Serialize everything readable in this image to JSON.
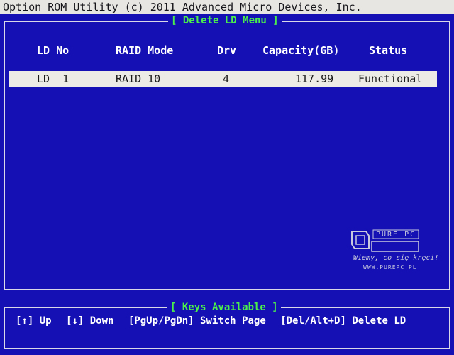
{
  "header": {
    "title": "Option ROM Utility (c) 2011 Advanced Micro Devices, Inc."
  },
  "delete_menu": {
    "title": "[ Delete LD Menu ]",
    "columns": [
      "LD No",
      "RAID Mode",
      "Drv",
      "Capacity(GB)",
      "Status"
    ],
    "rows": [
      {
        "ld_no": "LD  1",
        "raid_mode": "RAID 10",
        "drv": "4",
        "capacity": "117.99",
        "status": "Functional"
      }
    ]
  },
  "keys_panel": {
    "title": "[ Keys Available ]",
    "keys": [
      "[↑] Up",
      "[↓] Down",
      "[PgUp/PgDn] Switch Page",
      "[Del/Alt+D] Delete LD"
    ]
  },
  "watermark": {
    "logo_text": "PURE PC",
    "slogan": "Wiemy, co się kręci!",
    "url": "WWW.PUREPC.PL"
  },
  "colors": {
    "background": "#1410b4",
    "title_text": "#4cf04c",
    "highlight_row": "#ecebe6",
    "header_bar": "#e8e6e2"
  }
}
